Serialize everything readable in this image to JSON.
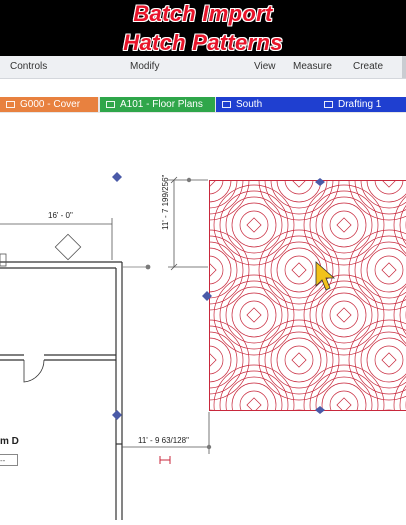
{
  "banner": {
    "line1": "Batch Import",
    "line2": "Hatch Patterns"
  },
  "ribbon": {
    "items": [
      "Controls",
      "Modify",
      "View",
      "Measure",
      "Create"
    ]
  },
  "tabs": [
    {
      "label": "G000 - Cover",
      "color": "#e8813f"
    },
    {
      "label": "A101 - Floor Plans",
      "color": "#2fa64a"
    },
    {
      "label": "South",
      "color": "#1f3fd0"
    },
    {
      "label": "Drafting 1",
      "color": "#1f3fd0"
    }
  ],
  "drawing": {
    "dim_top": "16' - 0\"",
    "dim_vertical": "11' - 7 199/256\"",
    "dim_bottom": "11' - 9 63/128\"",
    "room_name": "m D",
    "room_box": "--"
  },
  "colors": {
    "hatch_line": "#c8283c",
    "grip": "#4a5aa8",
    "wall": "#333333"
  }
}
